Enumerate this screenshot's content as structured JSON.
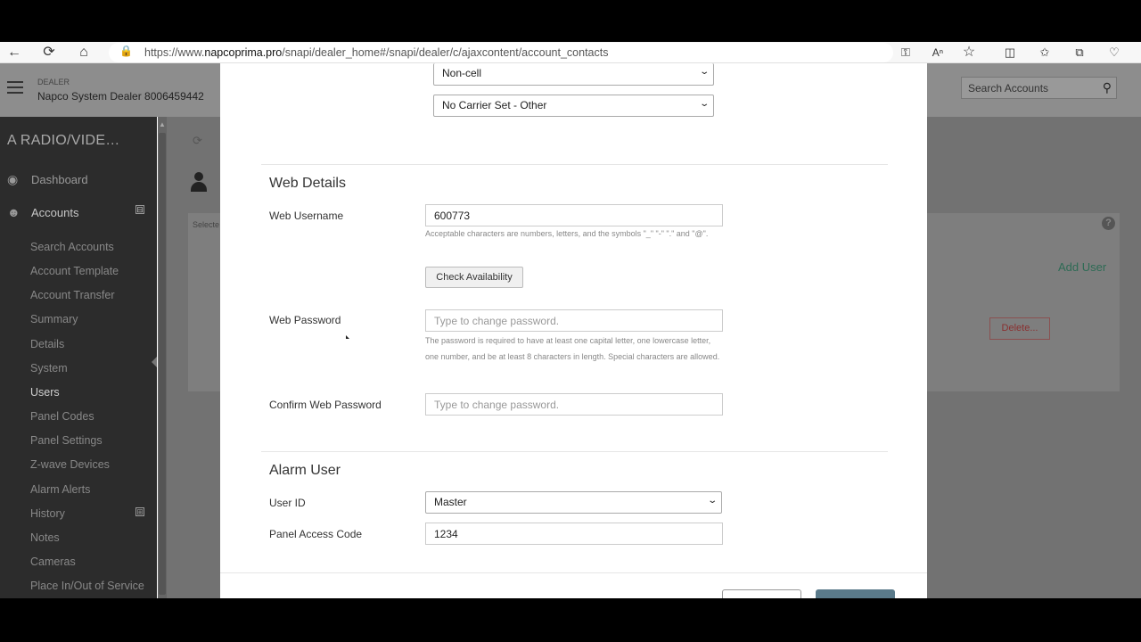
{
  "browser": {
    "url_prefix": "https://www.",
    "url_domain": "napcoprima.pro",
    "url_path": "/snapi/dealer_home#/snapi/dealer/c/ajaxcontent/account_contacts"
  },
  "header": {
    "dealer_label": "DEALER",
    "dealer_name": "Napco System Dealer 8006459442",
    "search_placeholder": "Search Accounts"
  },
  "sidebar": {
    "account_title": "A RADIO/VIDE…",
    "top_items": [
      {
        "label": "Dashboard",
        "icon": "dashboard-icon"
      },
      {
        "label": "Accounts",
        "icon": "users-icon",
        "toggle": "⊟"
      }
    ],
    "sub_items": [
      {
        "label": "Search Accounts"
      },
      {
        "label": "Account Template"
      },
      {
        "label": "Account Transfer"
      },
      {
        "label": "Summary"
      },
      {
        "label": "Details"
      },
      {
        "label": "System"
      },
      {
        "label": "Users",
        "active": true
      },
      {
        "label": "Panel Codes"
      },
      {
        "label": "Panel Settings"
      },
      {
        "label": "Z-wave Devices"
      },
      {
        "label": "Alarm Alerts"
      },
      {
        "label": "History",
        "toggle": "⊞"
      },
      {
        "label": "Notes"
      },
      {
        "label": "Cameras"
      },
      {
        "label": "Place In/Out of Service"
      }
    ]
  },
  "background": {
    "selected_text": "Selecte",
    "add_user": "Add User",
    "delete_button": "Delete..."
  },
  "modal": {
    "phone_type": "Non-cell",
    "carrier": "No Carrier Set - Other",
    "web_details": {
      "title": "Web Details",
      "username_label": "Web Username",
      "username_value": "600773",
      "username_help": "Acceptable characters are numbers, letters, and the symbols \"_\" \"-\" \".\" and \"@\".",
      "check_button": "Check Availability",
      "password_label": "Web Password",
      "password_placeholder": "Type to change password.",
      "password_help": "The password is required to have at least one capital letter, one lowercase letter, one number, and be at least 8 characters in length. Special characters are allowed.",
      "confirm_label": "Confirm Web Password",
      "confirm_placeholder": "Type to change password."
    },
    "alarm_user": {
      "title": "Alarm User",
      "user_id_label": "User ID",
      "user_id_value": "Master",
      "access_code_label": "Panel Access Code",
      "access_code_value": "1234"
    }
  }
}
